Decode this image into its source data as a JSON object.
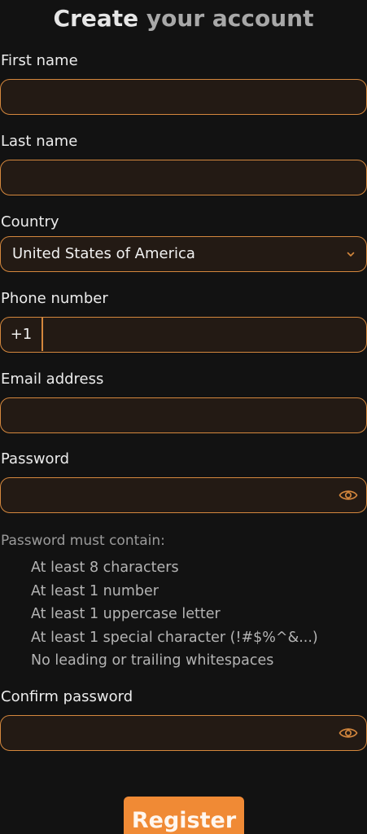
{
  "header": {
    "title_part1": "Create ",
    "title_part2": "your account"
  },
  "form": {
    "first_name": {
      "label": "First name",
      "value": ""
    },
    "last_name": {
      "label": "Last name",
      "value": ""
    },
    "country": {
      "label": "Country",
      "value": "United States of America",
      "icon": "chevron-down-icon"
    },
    "phone": {
      "label": "Phone number",
      "prefix": "+1",
      "value": ""
    },
    "email": {
      "label": "Email address",
      "value": ""
    },
    "password": {
      "label": "Password",
      "value": "",
      "icon": "eye-icon"
    },
    "password_rules": {
      "title": "Password must contain:",
      "items": [
        "At least 8 characters",
        "At least 1 number",
        "At least 1 uppercase letter",
        "At least 1 special character (!#$%^&...)",
        "No leading or trailing whitespaces"
      ]
    },
    "confirm_password": {
      "label": "Confirm password",
      "value": "",
      "icon": "eye-icon"
    },
    "register_label": "Register"
  },
  "colors": {
    "accent": "#f08a35",
    "field_border": "#d4873d",
    "field_background": "#231a14",
    "page_background": "#121212"
  }
}
